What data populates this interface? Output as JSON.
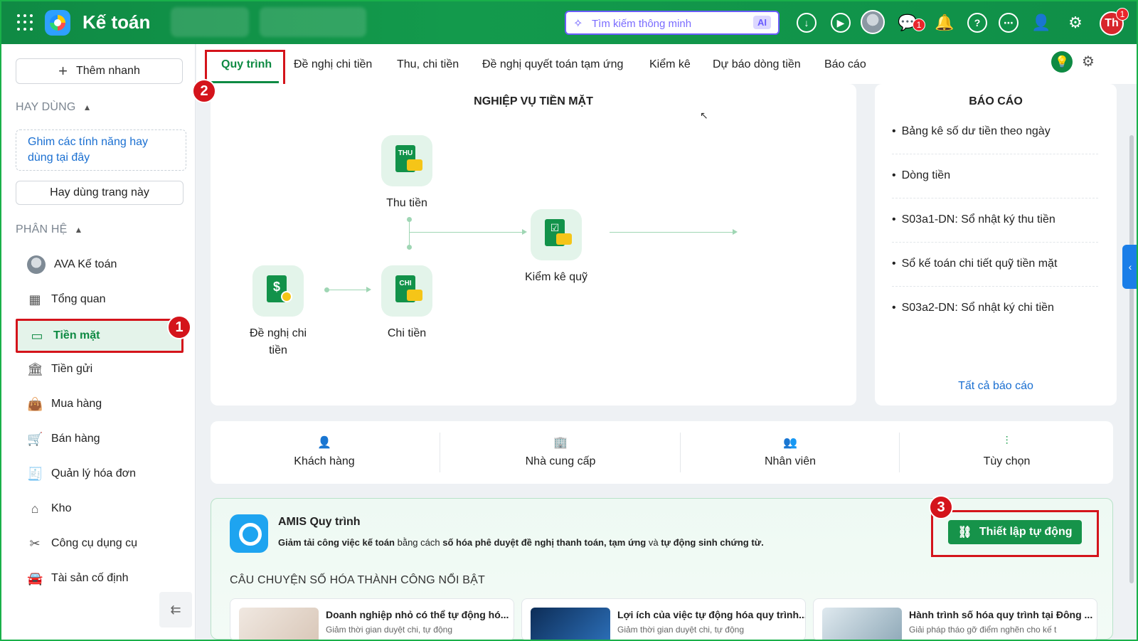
{
  "app": {
    "title": "Kế toán"
  },
  "topbar": {
    "search_placeholder": "Tìm kiếm thông minh",
    "ai_label": "AI",
    "chat_badge": "1",
    "user_initials": "Th",
    "user_badge": "1"
  },
  "sidebar": {
    "quick_add": "Thêm nhanh",
    "frequent_heading": "HAY DÙNG",
    "pin_hint": "Ghim các tính năng hay dùng tại đây",
    "pin_page_button": "Hay dùng trang này",
    "modules_heading": "PHÂN HỆ",
    "items": [
      {
        "label": "AVA Kế toán",
        "icon": "ava-avatar"
      },
      {
        "label": "Tổng quan",
        "icon": "dashboard-icon"
      },
      {
        "label": "Tiền mặt",
        "icon": "cash-icon",
        "active": true
      },
      {
        "label": "Tiền gửi",
        "icon": "bank-icon"
      },
      {
        "label": "Mua hàng",
        "icon": "shopping-bag-icon"
      },
      {
        "label": "Bán hàng",
        "icon": "cart-icon"
      },
      {
        "label": "Quản lý hóa đơn",
        "icon": "invoice-icon"
      },
      {
        "label": "Kho",
        "icon": "warehouse-icon"
      },
      {
        "label": "Công cụ dụng cụ",
        "icon": "tools-icon"
      },
      {
        "label": "Tài sản cố định",
        "icon": "car-icon"
      }
    ]
  },
  "tabs": [
    {
      "label": "Quy trình",
      "active": true
    },
    {
      "label": "Đề nghị chi tiền"
    },
    {
      "label": "Thu, chi tiền"
    },
    {
      "label": "Đề nghị quyết toán tạm ứng"
    },
    {
      "label": "Kiểm kê"
    },
    {
      "label": "Dự báo dòng tiền"
    },
    {
      "label": "Báo cáo"
    }
  ],
  "annotations": [
    "1",
    "2",
    "3"
  ],
  "workflow": {
    "title": "NGHIỆP VỤ TIỀN MẶT",
    "nodes": {
      "thu": {
        "label": "Thu tiền",
        "doc_text": "THU"
      },
      "chi": {
        "label": "Chi tiền",
        "doc_text": "CHI"
      },
      "de_nghi": {
        "label": "Đề nghị chi tiền"
      },
      "kiem_ke": {
        "label": "Kiểm kê quỹ"
      }
    }
  },
  "reports": {
    "title": "BÁO CÁO",
    "items": [
      "Bảng kê số dư tiền theo ngày",
      "Dòng tiền",
      "S03a1-DN: Sổ nhật ký thu tiền",
      "Sổ kế toán chi tiết quỹ tiền mặt",
      "S03a2-DN: Sổ nhật ký chi tiền"
    ],
    "all_link": "Tất cả báo cáo"
  },
  "categories": [
    {
      "label": "Khách hàng",
      "icon": "customer-icon"
    },
    {
      "label": "Nhà cung cấp",
      "icon": "supplier-icon"
    },
    {
      "label": "Nhân viên",
      "icon": "employees-icon"
    },
    {
      "label": "Tùy chọn",
      "icon": "options-icon"
    }
  ],
  "amis": {
    "title": "AMIS Quy trình",
    "desc_1": "Giảm tải công việc kế toán",
    "desc_2": " bằng cách ",
    "desc_3": "số hóa phê duyệt đề nghị thanh toán, tạm ứng",
    "desc_4": " và ",
    "desc_5": "tự động sinh chứng từ.",
    "setup_button": "Thiết lập tự động",
    "stories_heading": "CÂU CHUYỆN SỐ HÓA THÀNH CÔNG NỔI BẬT",
    "stories": [
      {
        "title": "Doanh nghiệp nhỏ có thể tự động hó...",
        "subtitle": "Giảm thời gian duyệt chi, tự động"
      },
      {
        "title": "Lợi ích của việc tự động hóa quy trình...",
        "subtitle": "Giảm thời gian duyệt chi, tự động"
      },
      {
        "title": "Hành trình số hóa quy trình tại Đông ...",
        "subtitle": "Giải pháp tháo gỡ điểm nghẽn cho kế t"
      }
    ]
  }
}
